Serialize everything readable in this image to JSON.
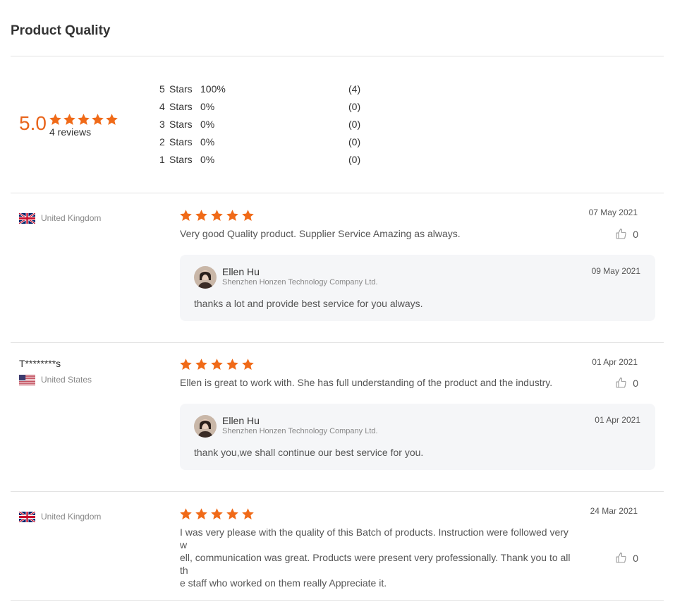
{
  "title": "Product Quality",
  "summary": {
    "score": "5.0",
    "rating": 5,
    "reviews_label": "4 reviews",
    "star_color": "#f06a18",
    "distribution": [
      {
        "stars": "5",
        "label": "Stars",
        "percent": "100%",
        "count": "(4)"
      },
      {
        "stars": "4",
        "label": "Stars",
        "percent": "0%",
        "count": "(0)"
      },
      {
        "stars": "3",
        "label": "Stars",
        "percent": "0%",
        "count": "(0)"
      },
      {
        "stars": "2",
        "label": "Stars",
        "percent": "0%",
        "count": "(0)"
      },
      {
        "stars": "1",
        "label": "Stars",
        "percent": "0%",
        "count": "(0)"
      }
    ]
  },
  "reviews": [
    {
      "user": "",
      "country": "United Kingdom",
      "flag_icon": "uk-flag-icon",
      "rating": 5,
      "date": "07 May 2021",
      "text": "Very good Quality product. Supplier Service Amazing as always.",
      "likes": "0",
      "reply": {
        "name": "Ellen Hu",
        "company": "Shenzhen Honzen Technology Company Ltd.",
        "date": "09 May 2021",
        "message": "thanks a lot and provide best service for you always."
      }
    },
    {
      "user": "T********s",
      "country": "United States",
      "flag_icon": "us-flag-icon",
      "rating": 5,
      "date": "01 Apr 2021",
      "text": "Ellen is great to work with.  She has full understanding of the product and the industry.",
      "likes": "0",
      "reply": {
        "name": "Ellen Hu",
        "company": "Shenzhen Honzen Technology Company Ltd.",
        "date": "01 Apr 2021",
        "message": "thank you,we shall continue our best service for you."
      }
    },
    {
      "user": "",
      "country": "United Kingdom",
      "flag_icon": "uk-flag-icon",
      "rating": 5,
      "date": "24 Mar 2021",
      "text_lines": [
        "I was very please with the quality of this Batch of products. Instruction were followed very w",
        "ell, communication was great. Products were present very professionally. Thank you to all th",
        "e staff who worked on them really Appreciate it."
      ],
      "likes": "0"
    }
  ]
}
